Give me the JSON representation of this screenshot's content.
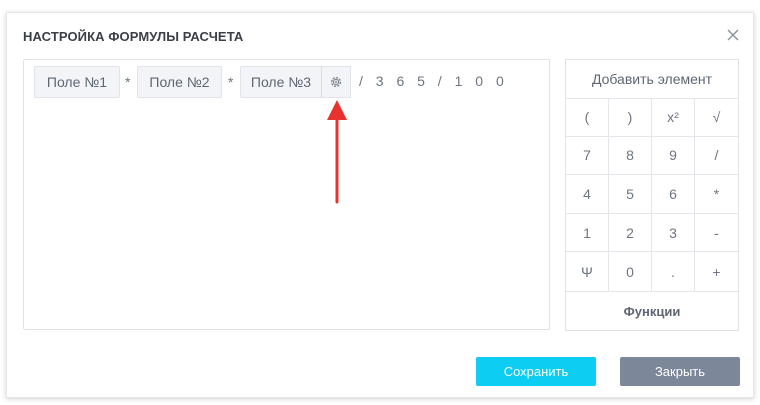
{
  "dialog": {
    "title": "НАСТРОЙКА ФОРМУЛЫ РАСЧЕТА",
    "close_icon": "close-icon"
  },
  "formula": {
    "tokens": [
      "Поле №1",
      "Поле №2",
      "Поле №3"
    ],
    "operators": [
      "*",
      "*"
    ],
    "settings_icon": "gear-icon",
    "tail": "/ 3 6 5 / 1 0 0",
    "annotation_icon": "red-arrow-icon"
  },
  "keypad": {
    "header": "Добавить элемент",
    "keys": [
      "(",
      ")",
      "x²",
      "√",
      "7",
      "8",
      "9",
      "/",
      "4",
      "5",
      "6",
      "*",
      "1",
      "2",
      "3",
      "-",
      "Ψ",
      "0",
      ".",
      "+"
    ],
    "footer": "Функции"
  },
  "actions": {
    "save_label": "Сохранить",
    "close_label": "Закрыть"
  },
  "colors": {
    "save": "#0dcdf2",
    "close": "#7c8799",
    "arrow": "#e8322e"
  }
}
